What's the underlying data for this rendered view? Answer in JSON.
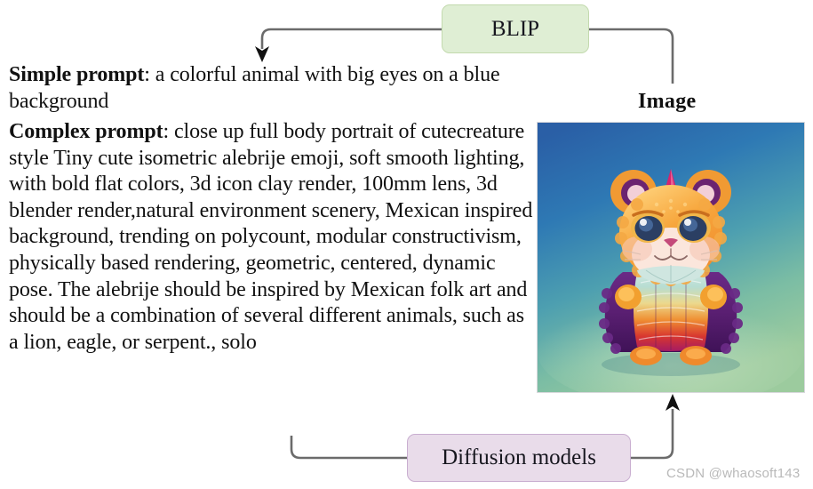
{
  "prompts": {
    "simple": {
      "label": "Simple prompt",
      "separator": ": ",
      "text": "a colorful animal with big eyes on a blue background"
    },
    "complex": {
      "label": "Complex prompt",
      "separator": ": ",
      "text": "close up full body portrait of cutecreature style Tiny cute isometric alebrije emoji, soft smooth lighting, with bold flat colors, 3d icon clay render, 100mm lens, 3d blender render,natural environment scenery, Mexican inspired background, trending on polycount, modular constructivism, physically based rendering, geometric, centered, dynamic pose. The alebrije should be inspired by Mexican folk art and should be a combination of several different animals, such as a lion, eagle, or serpent., solo"
    }
  },
  "nodes": {
    "blip": {
      "label": "BLIP",
      "fill": "#dfeed4",
      "border": "#c3daae"
    },
    "diffusion": {
      "label": "Diffusion models",
      "fill": "#e9dcea",
      "border": "#c9aed0"
    }
  },
  "image_panel": {
    "label": "Image",
    "alt": "ai-generated-cute-creature",
    "background_top": "#2a63a8",
    "background_bottom": "#8fc39a",
    "creature": {
      "fur": "#f5a13c",
      "fur_light": "#ffd07a",
      "body_purple": "#5c1f6e",
      "body_magenta": "#c0246e",
      "body_red": "#d8382c",
      "body_orange": "#ef7a22",
      "body_teal": "#bfe3da",
      "horn": "#d4246b",
      "eye": "#2b3f63",
      "nose": "#c44a7a"
    }
  },
  "connectors": {
    "stroke": "#6b6b6b",
    "arrow_color": "#111111",
    "blip_to_prompt": "arrow-left-down",
    "image_to_blip": "line-up-left",
    "prompt_to_diffusion": "line-left-up",
    "diffusion_to_image": "arrow-right-up"
  },
  "watermark": {
    "text": "CSDN @whaosoft143"
  }
}
